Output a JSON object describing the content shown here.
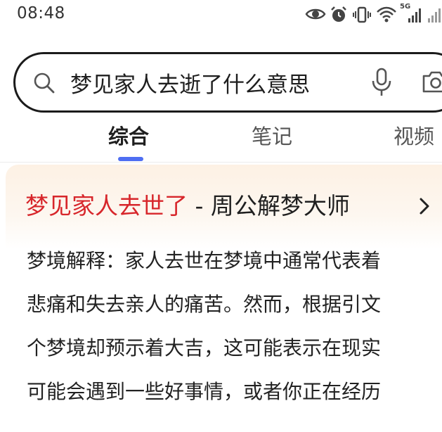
{
  "status_bar": {
    "time": "08:48",
    "network_label": "5G"
  },
  "search": {
    "query": "梦见家人去逝了什么意思",
    "icons": [
      "search-icon",
      "microphone-icon",
      "camera-icon"
    ]
  },
  "tabs": [
    {
      "label": "综合",
      "active": true
    },
    {
      "label": "笔记",
      "active": false
    },
    {
      "label": "视频",
      "active": false
    }
  ],
  "result_card": {
    "title_highlight": "梦见家人去世了",
    "title_rest": " - 周公解梦大师",
    "body_lines": [
      "梦境解释：家人去世在梦境中通常代表着",
      "悲痛和失去亲人的痛苦。然而，根据引文",
      "个梦境却预示着大吉，这可能表示在现实",
      "可能会遇到一些好事情，或者你正在经历"
    ]
  },
  "colors": {
    "accent_blue": "#4e6ef2",
    "title_red": "#d7262b",
    "card_header_bg": "#fdf1e4"
  }
}
